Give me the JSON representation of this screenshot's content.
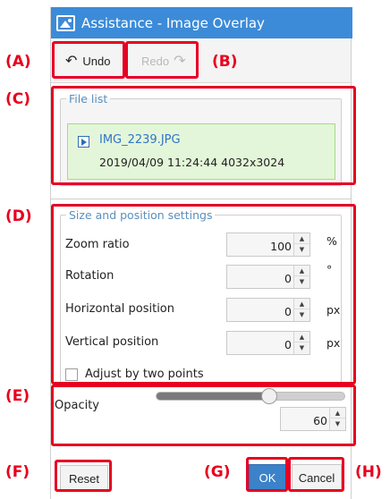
{
  "window": {
    "title": "Assistance - Image Overlay"
  },
  "toolbar": {
    "undo_label": "Undo",
    "redo_label": "Redo"
  },
  "file_list": {
    "legend": "File list",
    "items": [
      {
        "name": "IMG_2239.JPG",
        "details": "2019/04/09 11:24:44  4032x3024"
      }
    ]
  },
  "settings": {
    "legend": "Size and position settings",
    "fields": [
      {
        "label": "Zoom ratio",
        "value": "100",
        "unit": "%"
      },
      {
        "label": "Rotation",
        "value": "0",
        "unit": "°"
      },
      {
        "label": "Horizontal position",
        "value": "0",
        "unit": "px"
      },
      {
        "label": "Vertical position",
        "value": "0",
        "unit": "px"
      }
    ],
    "adjust_label": "Adjust by two points",
    "adjust_checked": false
  },
  "opacity": {
    "label": "Opacity",
    "value": "60",
    "slider_fraction": 0.6
  },
  "buttons": {
    "reset": "Reset",
    "ok": "OK",
    "cancel": "Cancel"
  },
  "callouts": [
    "(A)",
    "(B)",
    "(C)",
    "(D)",
    "(E)",
    "(F)",
    "(G)",
    "(H)"
  ],
  "colors": {
    "titlebar": "#3c8bd8",
    "accent_blue": "#3b82c9",
    "callout_red": "#e8001d",
    "file_selected_bg": "#e4f6d9"
  }
}
